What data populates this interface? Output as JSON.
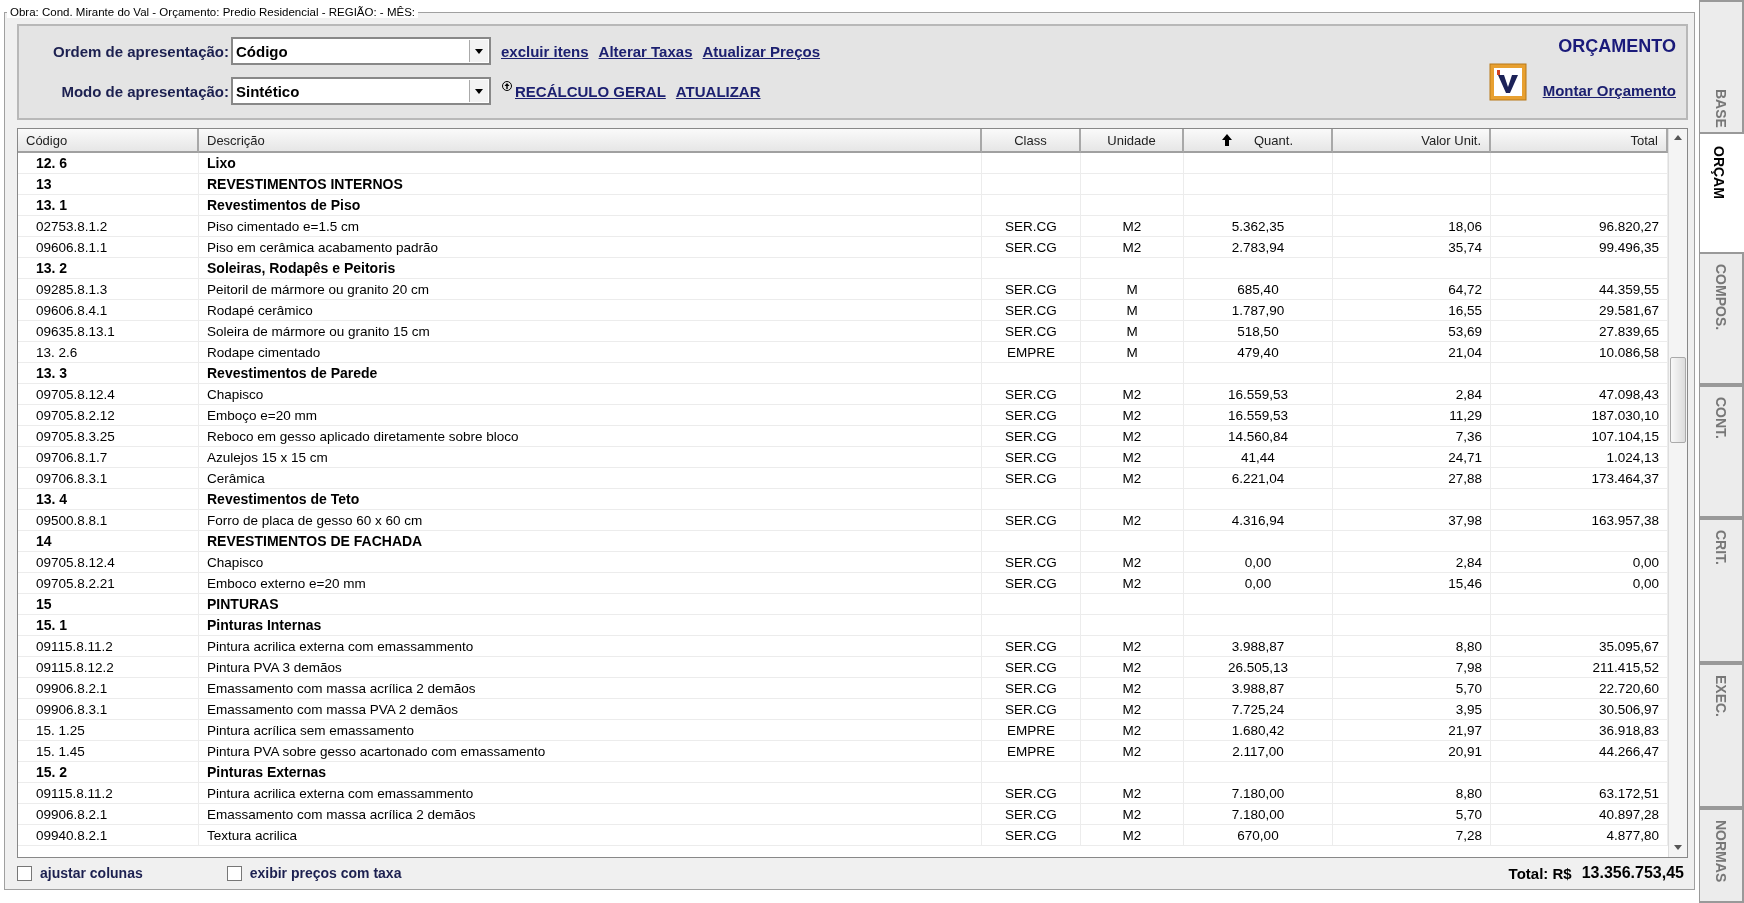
{
  "group_title": "Obra: Cond. Mirante do Val - Orçamento: Predio Residencial - REGIÃO:  - MÊS:",
  "toolbar": {
    "order": {
      "label": "Ordem de apresentação:",
      "value": "Código"
    },
    "mode": {
      "label": "Modo de apresentação:",
      "value": "Sintético"
    },
    "links_row_1": [
      "excluir itens",
      "Alterar Taxas",
      "Atualizar Preços"
    ],
    "links_row_2": [
      "RECÁLCULO GERAL",
      "ATUALIZAR"
    ],
    "heading": "ORÇAMENTO",
    "assemble_link": "Montar Orçamento"
  },
  "table": {
    "columns": [
      {
        "label": "Código",
        "sorted": false
      },
      {
        "label": "Descrição",
        "sorted": false
      },
      {
        "label": "Class",
        "sorted": false
      },
      {
        "label": "Unidade",
        "sorted": false
      },
      {
        "label": "Quant.",
        "sorted": true
      },
      {
        "label": "Valor Unit.",
        "sorted": false
      },
      {
        "label": "Total",
        "sorted": false
      }
    ],
    "rows": [
      {
        "kind": "group",
        "cells": [
          "12. 6",
          "Lixo"
        ]
      },
      {
        "kind": "group",
        "cells": [
          "13",
          "REVESTIMENTOS  INTERNOS"
        ]
      },
      {
        "kind": "group",
        "cells": [
          "13. 1",
          "Revestimentos de Piso"
        ]
      },
      {
        "kind": "item",
        "cells": [
          "02753.8.1.2",
          "Piso cimentado e=1.5 cm",
          "SER.CG",
          "M2",
          "5.362,35",
          "18,06",
          "96.820,27"
        ]
      },
      {
        "kind": "item",
        "cells": [
          "09606.8.1.1",
          "Piso em cerâmica acabamento padrão",
          "SER.CG",
          "M2",
          "2.783,94",
          "35,74",
          "99.496,35"
        ]
      },
      {
        "kind": "group",
        "cells": [
          "13. 2",
          "Soleiras, Rodapês e Peitoris"
        ]
      },
      {
        "kind": "item",
        "cells": [
          "09285.8.1.3",
          "Peitoril de mármore ou granito 20 cm",
          "SER.CG",
          "M",
          "685,40",
          "64,72",
          "44.359,55"
        ]
      },
      {
        "kind": "item",
        "cells": [
          "09606.8.4.1",
          "Rodapé cerâmico",
          "SER.CG",
          "M",
          "1.787,90",
          "16,55",
          "29.581,67"
        ]
      },
      {
        "kind": "item",
        "cells": [
          "09635.8.13.1",
          "Soleira de mármore ou granito 15 cm",
          "SER.CG",
          "M",
          "518,50",
          "53,69",
          "27.839,65"
        ]
      },
      {
        "kind": "item",
        "cells": [
          "13. 2.6",
          "Rodape cimentado",
          "EMPRE",
          "M",
          "479,40",
          "21,04",
          "10.086,58"
        ]
      },
      {
        "kind": "group",
        "cells": [
          "13. 3",
          "Revestimentos de Parede"
        ]
      },
      {
        "kind": "item",
        "cells": [
          "09705.8.12.4",
          "Chapisco",
          "SER.CG",
          "M2",
          "16.559,53",
          "2,84",
          "47.098,43"
        ]
      },
      {
        "kind": "item",
        "cells": [
          "09705.8.2.12",
          "Emboço e=20 mm",
          "SER.CG",
          "M2",
          "16.559,53",
          "11,29",
          "187.030,10"
        ]
      },
      {
        "kind": "item",
        "cells": [
          "09705.8.3.25",
          "Reboco em gesso aplicado diretamente sobre bloco",
          "SER.CG",
          "M2",
          "14.560,84",
          "7,36",
          "107.104,15"
        ]
      },
      {
        "kind": "item",
        "cells": [
          "09706.8.1.7",
          "Azulejos 15 x 15 cm",
          "SER.CG",
          "M2",
          "41,44",
          "24,71",
          "1.024,13"
        ]
      },
      {
        "kind": "item",
        "cells": [
          "09706.8.3.1",
          "Cerâmica",
          "SER.CG",
          "M2",
          "6.221,04",
          "27,88",
          "173.464,37"
        ]
      },
      {
        "kind": "group",
        "cells": [
          "13. 4",
          "Revestimentos de Teto"
        ]
      },
      {
        "kind": "item",
        "cells": [
          "09500.8.8.1",
          "Forro de placa de gesso 60 x 60 cm",
          "SER.CG",
          "M2",
          "4.316,94",
          "37,98",
          "163.957,38"
        ]
      },
      {
        "kind": "group",
        "cells": [
          "14",
          "REVESTIMENTOS DE FACHADA"
        ]
      },
      {
        "kind": "item",
        "cells": [
          "09705.8.12.4",
          "Chapisco",
          "SER.CG",
          "M2",
          "0,00",
          "2,84",
          "0,00"
        ]
      },
      {
        "kind": "item",
        "cells": [
          "09705.8.2.21",
          "Emboco externo e=20 mm",
          "SER.CG",
          "M2",
          "0,00",
          "15,46",
          "0,00"
        ]
      },
      {
        "kind": "group",
        "cells": [
          "15",
          "PINTURAS"
        ]
      },
      {
        "kind": "group",
        "cells": [
          "15. 1",
          "Pinturas Internas"
        ]
      },
      {
        "kind": "item",
        "cells": [
          "09115.8.11.2",
          "Pintura acrilica externa com emassammento",
          "SER.CG",
          "M2",
          "3.988,87",
          "8,80",
          "35.095,67"
        ]
      },
      {
        "kind": "item",
        "cells": [
          "09115.8.12.2",
          "Pintura PVA 3 demãos",
          "SER.CG",
          "M2",
          "26.505,13",
          "7,98",
          "211.415,52"
        ]
      },
      {
        "kind": "item",
        "cells": [
          "09906.8.2.1",
          "Emassamento com massa acrílica 2 demãos",
          "SER.CG",
          "M2",
          "3.988,87",
          "5,70",
          "22.720,60"
        ]
      },
      {
        "kind": "item",
        "cells": [
          "09906.8.3.1",
          "Emassamento com massa PVA 2 demãos",
          "SER.CG",
          "M2",
          "7.725,24",
          "3,95",
          "30.506,97"
        ]
      },
      {
        "kind": "item",
        "cells": [
          "15. 1.25",
          "Pintura acrílica sem emassamento",
          "EMPRE",
          "M2",
          "1.680,42",
          "21,97",
          "36.918,83"
        ]
      },
      {
        "kind": "item",
        "cells": [
          "15. 1.45",
          "Pintura PVA sobre gesso acartonado com emassamento",
          "EMPRE",
          "M2",
          "2.117,00",
          "20,91",
          "44.266,47"
        ]
      },
      {
        "kind": "group",
        "cells": [
          "15. 2",
          "Pinturas Externas"
        ]
      },
      {
        "kind": "item",
        "cells": [
          "09115.8.11.2",
          "Pintura acrilica externa com emassammento",
          "SER.CG",
          "M2",
          "7.180,00",
          "8,80",
          "63.172,51"
        ]
      },
      {
        "kind": "item",
        "cells": [
          "09906.8.2.1",
          "Emassamento com massa acrílica 2 demãos",
          "SER.CG",
          "M2",
          "7.180,00",
          "5,70",
          "40.897,28"
        ]
      },
      {
        "kind": "item",
        "cells": [
          "09940.8.2.1",
          "Textura acrilica",
          "SER.CG",
          "M2",
          "670,00",
          "7,28",
          "4.877,80"
        ]
      }
    ]
  },
  "footer": {
    "checkboxes": [
      {
        "label": "ajustar colunas",
        "checked": false
      },
      {
        "label": "exibir preços com taxa",
        "checked": false
      }
    ],
    "total_label": "Total: R$",
    "total_value": "13.356.753,45"
  },
  "side_tabs": [
    {
      "label": "BASE",
      "selected": false
    },
    {
      "label": "ORÇAM",
      "selected": true
    },
    {
      "label": "COMPOS.",
      "selected": false
    },
    {
      "label": "CONT.",
      "selected": false
    },
    {
      "label": "CRIT.",
      "selected": false
    },
    {
      "label": "EXEC.",
      "selected": false
    },
    {
      "label": "NORMAS",
      "selected": false
    }
  ]
}
